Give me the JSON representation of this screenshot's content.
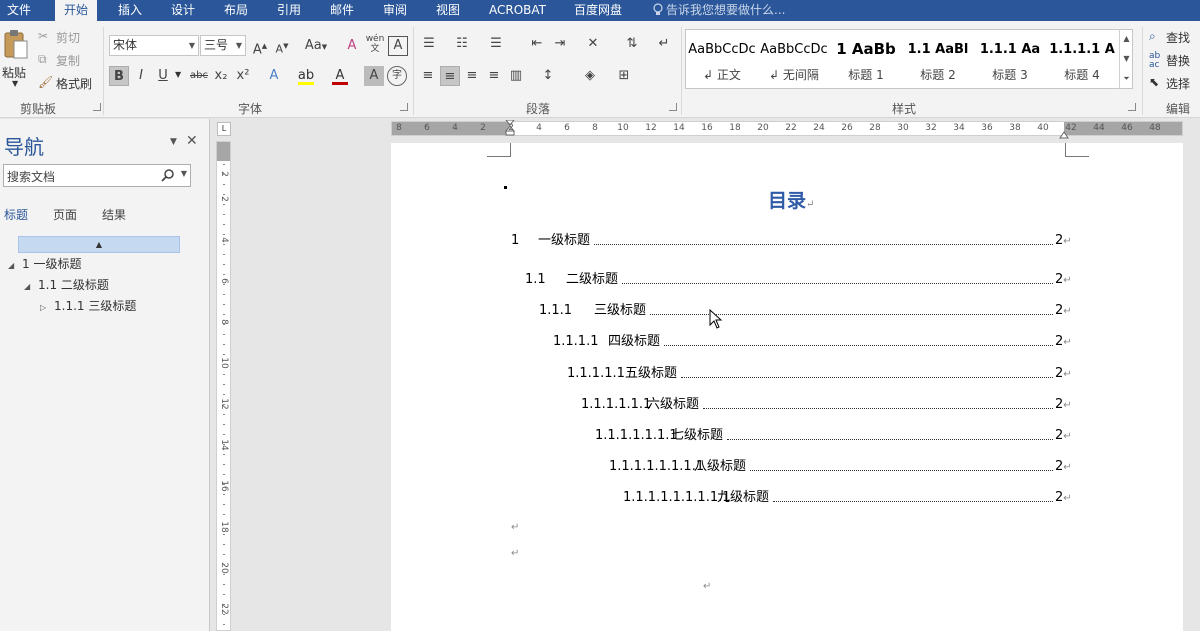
{
  "menu": {
    "tabs": [
      "文件",
      "开始",
      "插入",
      "设计",
      "布局",
      "引用",
      "邮件",
      "审阅",
      "视图",
      "ACROBAT",
      "百度网盘"
    ],
    "active": "开始",
    "tell_me": "告诉我您想要做什么..."
  },
  "ribbon": {
    "clipboard": {
      "label": "剪贴板",
      "paste": "粘贴",
      "cut": "剪切",
      "copy": "复制",
      "format_painter": "格式刷"
    },
    "font": {
      "label": "字体",
      "font_name": "宋体",
      "font_size": "三号",
      "buttons": [
        "B",
        "I",
        "U",
        "abc",
        "x₂",
        "x²"
      ],
      "phonetic": "wén"
    },
    "paragraph": {
      "label": "段落"
    },
    "styles": {
      "label": "样式",
      "items": [
        {
          "sample": "AaBbCcDc",
          "name": "正文"
        },
        {
          "sample": "AaBbCcDc",
          "name": "无间隔"
        },
        {
          "sample": "1 AaBb",
          "name": "标题 1"
        },
        {
          "sample": "1.1 AaBl",
          "name": "标题 2"
        },
        {
          "sample": "1.1.1 Aa",
          "name": "标题 3"
        },
        {
          "sample": "1.1.1.1 A",
          "name": "标题 4"
        }
      ]
    },
    "editing": {
      "label": "编辑",
      "find": "查找",
      "replace": "替换",
      "select": "选择"
    }
  },
  "nav": {
    "title": "导航",
    "search_placeholder": "搜索文档",
    "tabs": [
      "标题",
      "页面",
      "结果"
    ],
    "active_tab": "标题",
    "tree": [
      {
        "text": "1 一级标题",
        "level": 1,
        "toggle": "expanded"
      },
      {
        "text": "1.1 二级标题",
        "level": 2,
        "toggle": "expanded"
      },
      {
        "text": "1.1.1 三级标题",
        "level": 3,
        "toggle": "collapsed"
      }
    ]
  },
  "ruler": {
    "h_numbers": [
      "8",
      "6",
      "4",
      "2",
      "2",
      "4",
      "6",
      "8",
      "10",
      "12",
      "14",
      "16",
      "18",
      "20",
      "22",
      "24",
      "26",
      "28",
      "30",
      "32",
      "34",
      "36",
      "38",
      "40",
      "42",
      "44",
      "46",
      "48"
    ],
    "v_numbers": [
      "2",
      "2",
      "4",
      "6",
      "8",
      "10",
      "12",
      "14",
      "16",
      "18",
      "20",
      "22"
    ]
  },
  "document": {
    "toc_title": "目录",
    "para_mark": "↵",
    "toc": [
      {
        "num": "1",
        "label": "一级标题",
        "page": "2",
        "level": 1
      },
      {
        "num": "1.1",
        "label": "二级标题",
        "page": "2",
        "level": 2
      },
      {
        "num": "1.1.1",
        "label": "三级标题",
        "page": "2",
        "level": 3
      },
      {
        "num": "1.1.1.1",
        "label": "四级标题",
        "page": "2",
        "level": 4
      },
      {
        "num": "1.1.1.1.1",
        "label": "五级标题",
        "page": "2",
        "level": 5
      },
      {
        "num": "1.1.1.1.1.1",
        "label": "六级标题",
        "page": "2",
        "level": 6
      },
      {
        "num": "1.1.1.1.1.1.1",
        "label": "七级标题",
        "page": "2",
        "level": 7
      },
      {
        "num": "1.1.1.1.1.1.1.1",
        "label": "八级标题",
        "page": "2",
        "level": 8
      },
      {
        "num": "1.1.1.1.1.1.1.1.1",
        "label": "九级标题",
        "page": "2",
        "level": 9
      }
    ]
  },
  "colors": {
    "accent": "#2b579a",
    "heading": "#2e5aa7",
    "ribbon_bg": "#f3f3f3",
    "nav_selected": "#c5d9f1"
  }
}
